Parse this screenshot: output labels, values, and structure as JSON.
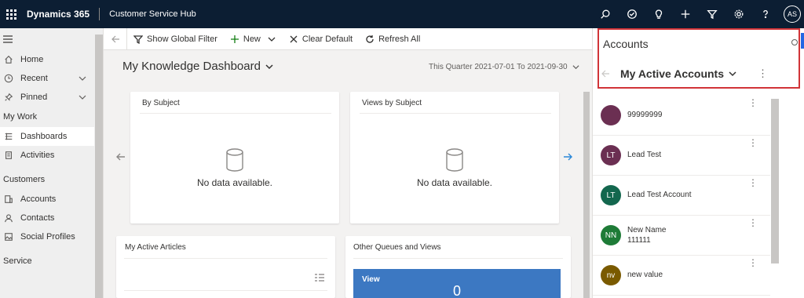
{
  "topbar": {
    "app_name": "Dynamics 365",
    "hub_name": "Customer Service Hub",
    "user_initials": "AS",
    "icons": [
      "search-icon",
      "target-icon",
      "lightbulb-icon",
      "plus-icon",
      "filter-icon",
      "gear-icon",
      "help-icon"
    ]
  },
  "sidebar": {
    "items": [
      {
        "label": "Home",
        "icon": "home-icon"
      },
      {
        "label": "Recent",
        "icon": "clock-icon"
      },
      {
        "label": "Pinned",
        "icon": "pin-icon"
      }
    ],
    "sections": [
      {
        "title": "My Work",
        "items": [
          {
            "label": "Dashboards",
            "icon": "dashboard-icon"
          },
          {
            "label": "Activities",
            "icon": "activities-icon"
          }
        ]
      },
      {
        "title": "Customers",
        "items": [
          {
            "label": "Accounts",
            "icon": "accounts-icon"
          },
          {
            "label": "Contacts",
            "icon": "person-icon"
          },
          {
            "label": "Social Profiles",
            "icon": "social-profiles-icon"
          }
        ]
      },
      {
        "title": "Service"
      }
    ]
  },
  "commandbar": {
    "show_global_filter": "Show Global Filter",
    "new": "New",
    "clear_default": "Clear Default",
    "refresh_all": "Refresh All"
  },
  "dashboard": {
    "title": "My Knowledge Dashboard",
    "date_range": "This Quarter 2021-07-01 To 2021-09-30",
    "cards": [
      {
        "title": "By Subject",
        "nodata": "No data available."
      },
      {
        "title": "Views by Subject",
        "nodata": "No data available."
      },
      {
        "title": "My Active Articles"
      },
      {
        "title": "Other Queues and Views"
      }
    ],
    "view_tile": {
      "label": "View",
      "count": "0"
    }
  },
  "panel": {
    "title": "Accounts",
    "view_name": "My Active Accounts",
    "accounts": [
      {
        "initials": "",
        "name": "99999999",
        "sub": "",
        "color": "#6b2f52"
      },
      {
        "initials": "LT",
        "name": "Lead Test",
        "sub": "",
        "color": "#6b2f52"
      },
      {
        "initials": "LT",
        "name": "Lead Test Account",
        "sub": "",
        "color": "#13674e"
      },
      {
        "initials": "NN",
        "name": "New Name",
        "sub": "111111",
        "color": "#1e7b37"
      },
      {
        "initials": "nv",
        "name": "new value",
        "sub": "",
        "color": "#7a5a00"
      }
    ]
  },
  "colors": {
    "topbar": "#0c1e33",
    "highlight": "#d13438",
    "view_tile": "#3c78c2"
  }
}
